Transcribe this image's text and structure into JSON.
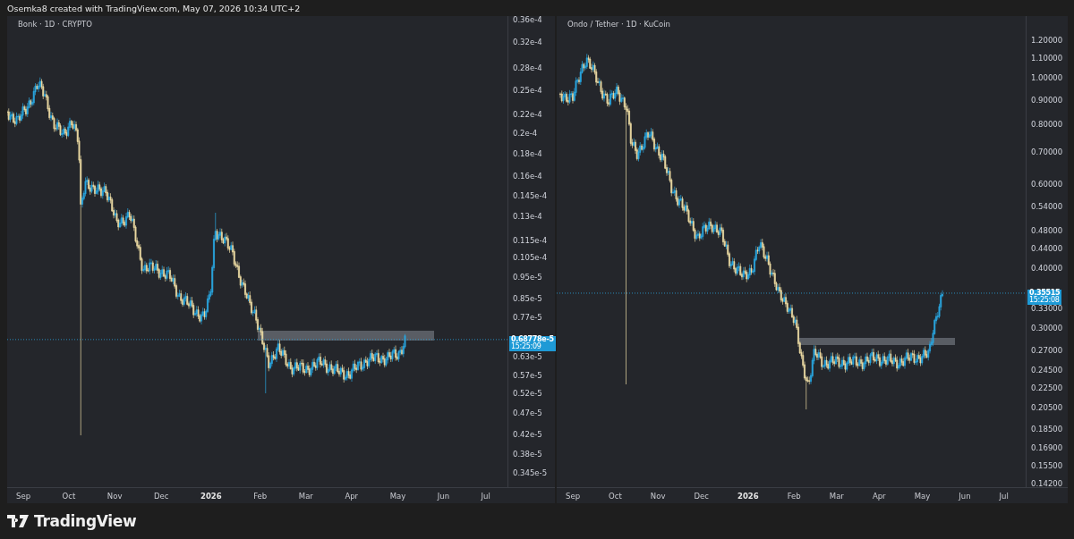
{
  "header": {
    "text": "Osemka8 created with TradingView.com, May 07, 2026 10:34 UTC+2"
  },
  "charts": [
    {
      "title": "Bonk · 1D · CRYPTO",
      "price_ticks": [
        "0.36e-4",
        "0.32e-4",
        "0.28e-4",
        "0.25e-4",
        "0.22e-4",
        "0.2e-4",
        "0.18e-4",
        "0.16e-4",
        "0.145e-4",
        "0.13e-4",
        "0.115e-4",
        "0.105e-4",
        "0.95e-5",
        "0.85e-5",
        "0.77e-5",
        "0.63e-5",
        "0.57e-5",
        "0.52e-5",
        "0.47e-5",
        "0.42e-5",
        "0.38e-5",
        "0.345e-5"
      ],
      "last_price": {
        "price": "0.68778e-5",
        "countdown": "15:25:09"
      },
      "time_ticks": [
        {
          "label": "Sep",
          "kind": "month"
        },
        {
          "label": "Oct",
          "kind": "month"
        },
        {
          "label": "Nov",
          "kind": "month"
        },
        {
          "label": "Dec",
          "kind": "month"
        },
        {
          "label": "2026",
          "kind": "year"
        },
        {
          "label": "Feb",
          "kind": "month"
        },
        {
          "label": "Mar",
          "kind": "month"
        },
        {
          "label": "Apr",
          "kind": "month"
        },
        {
          "label": "May",
          "kind": "month"
        },
        {
          "label": "Jun",
          "kind": "month"
        },
        {
          "label": "Jul",
          "kind": "month"
        }
      ]
    },
    {
      "title": "Ondo / Tether · 1D · KuCoin",
      "price_ticks": [
        "1.20000",
        "1.10000",
        "1.00000",
        "0.90000",
        "0.80000",
        "0.70000",
        "0.60000",
        "0.54000",
        "0.48000",
        "0.44000",
        "0.40000",
        "0.33000",
        "0.30000",
        "0.27000",
        "0.24500",
        "0.22500",
        "0.20500",
        "0.18500",
        "0.16900",
        "0.15500",
        "0.14200"
      ],
      "last_price": {
        "price": "0.35515",
        "countdown": "15:25:08"
      },
      "time_ticks": [
        {
          "label": "Sep",
          "kind": "month"
        },
        {
          "label": "Oct",
          "kind": "month"
        },
        {
          "label": "Nov",
          "kind": "month"
        },
        {
          "label": "Dec",
          "kind": "month"
        },
        {
          "label": "2026",
          "kind": "year"
        },
        {
          "label": "Feb",
          "kind": "month"
        },
        {
          "label": "Mar",
          "kind": "month"
        },
        {
          "label": "Apr",
          "kind": "month"
        },
        {
          "label": "May",
          "kind": "month"
        },
        {
          "label": "Jun",
          "kind": "month"
        },
        {
          "label": "Jul",
          "kind": "month"
        }
      ]
    }
  ],
  "footer": {
    "brand": "TradingView"
  }
}
